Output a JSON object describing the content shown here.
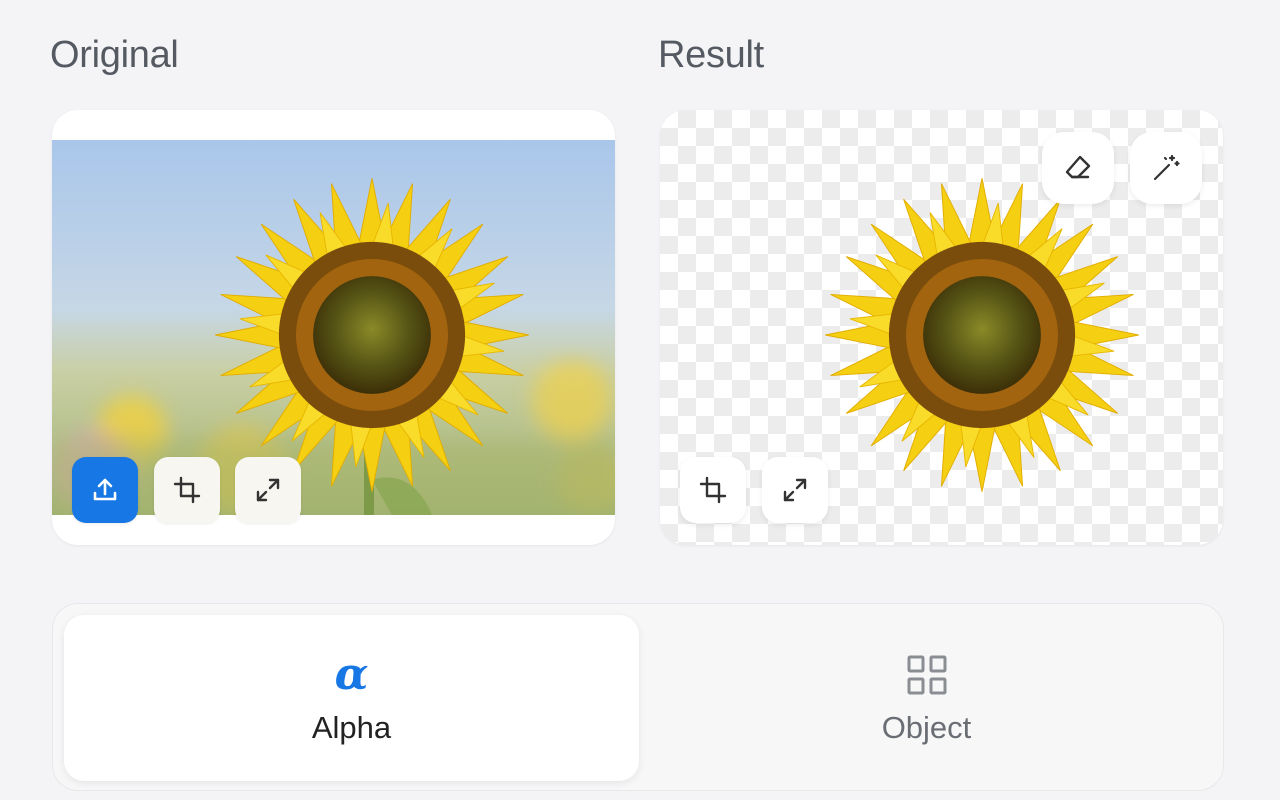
{
  "labels": {
    "original": "Original",
    "result": "Result"
  },
  "original_card": {
    "buttons": [
      {
        "name": "upload-button",
        "icon": "upload-icon"
      },
      {
        "name": "crop-button",
        "icon": "crop-icon"
      },
      {
        "name": "expand-button",
        "icon": "expand-icon"
      }
    ]
  },
  "result_card": {
    "top_buttons": [
      {
        "name": "eraser-button",
        "icon": "eraser-icon"
      },
      {
        "name": "magic-wand-button",
        "icon": "magic-wand-icon"
      }
    ],
    "bottom_buttons": [
      {
        "name": "crop-button",
        "icon": "crop-icon"
      },
      {
        "name": "expand-button",
        "icon": "expand-icon"
      }
    ]
  },
  "modes": [
    {
      "label": "Alpha",
      "icon": "alpha-icon",
      "active": true
    },
    {
      "label": "Object",
      "icon": "grid-icon",
      "active": false
    }
  ],
  "colors": {
    "accent": "#1677e5",
    "sky": "#a9c6ea",
    "petal": "#f5cf12",
    "center": "#5e5a14"
  }
}
